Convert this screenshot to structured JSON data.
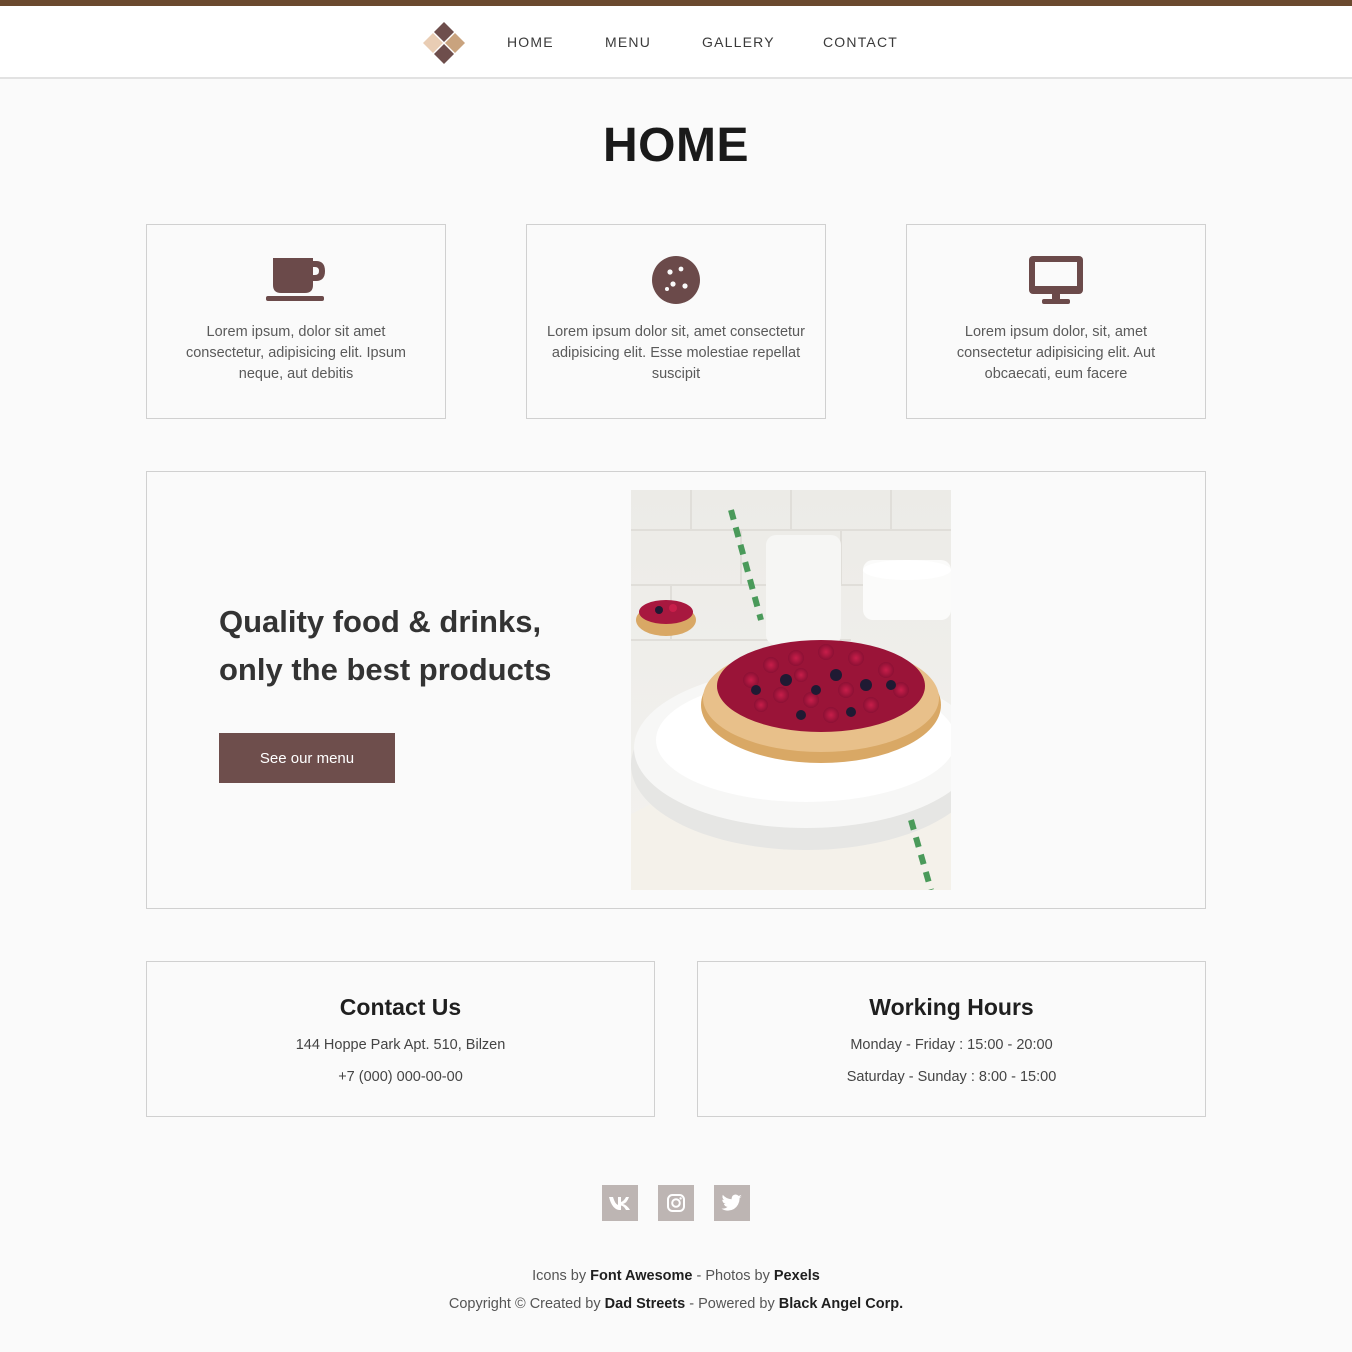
{
  "nav": {
    "items": [
      {
        "label": "HOME"
      },
      {
        "label": "MENU"
      },
      {
        "label": "GALLERY"
      },
      {
        "label": "CONTACT"
      }
    ]
  },
  "page": {
    "title": "HOME"
  },
  "features": [
    {
      "icon": "coffee-cup-icon",
      "text": "Lorem ipsum, dolor sit amet consectetur, adipisicing elit. Ipsum neque, aut debitis"
    },
    {
      "icon": "cookie-icon",
      "text": "Lorem ipsum dolor sit, amet consectetur adipisicing elit. Esse molestiae repellat suscipit"
    },
    {
      "icon": "desktop-monitor-icon",
      "text": "Lorem ipsum dolor, sit, amet consectetur adipisicing elit. Aut obcaecati, eum facere"
    }
  ],
  "hero": {
    "heading_line1": "Quality food & drinks,",
    "heading_line2": "only the best products",
    "button_label": "See our menu"
  },
  "contact": {
    "title": "Contact Us",
    "address": "144 Hoppe Park Apt. 510, Bilzen",
    "phone": "+7 (000) 000-00-00"
  },
  "hours": {
    "title": "Working Hours",
    "weekdays": "Monday - Friday : 15:00 - 20:00",
    "weekend": "Saturday - Sunday : 8:00 - 15:00"
  },
  "social": [
    "vk-icon",
    "instagram-icon",
    "twitter-icon"
  ],
  "footer": {
    "icons_prefix": "Icons by",
    "icons_link": "Font Awesome",
    "photos_sep": "- Photos by",
    "photos_link": "Pexels",
    "copyright_prefix": "Copyright © Created by",
    "creator_link": "Dad Streets",
    "powered_sep": "- Powered by",
    "powered_link": "Black Angel Corp."
  },
  "colors": {
    "accent_bar": "#6b4a2f",
    "button": "#6e4e4c",
    "icon": "#6b4a4a",
    "social_bg": "#bdb5b3"
  }
}
